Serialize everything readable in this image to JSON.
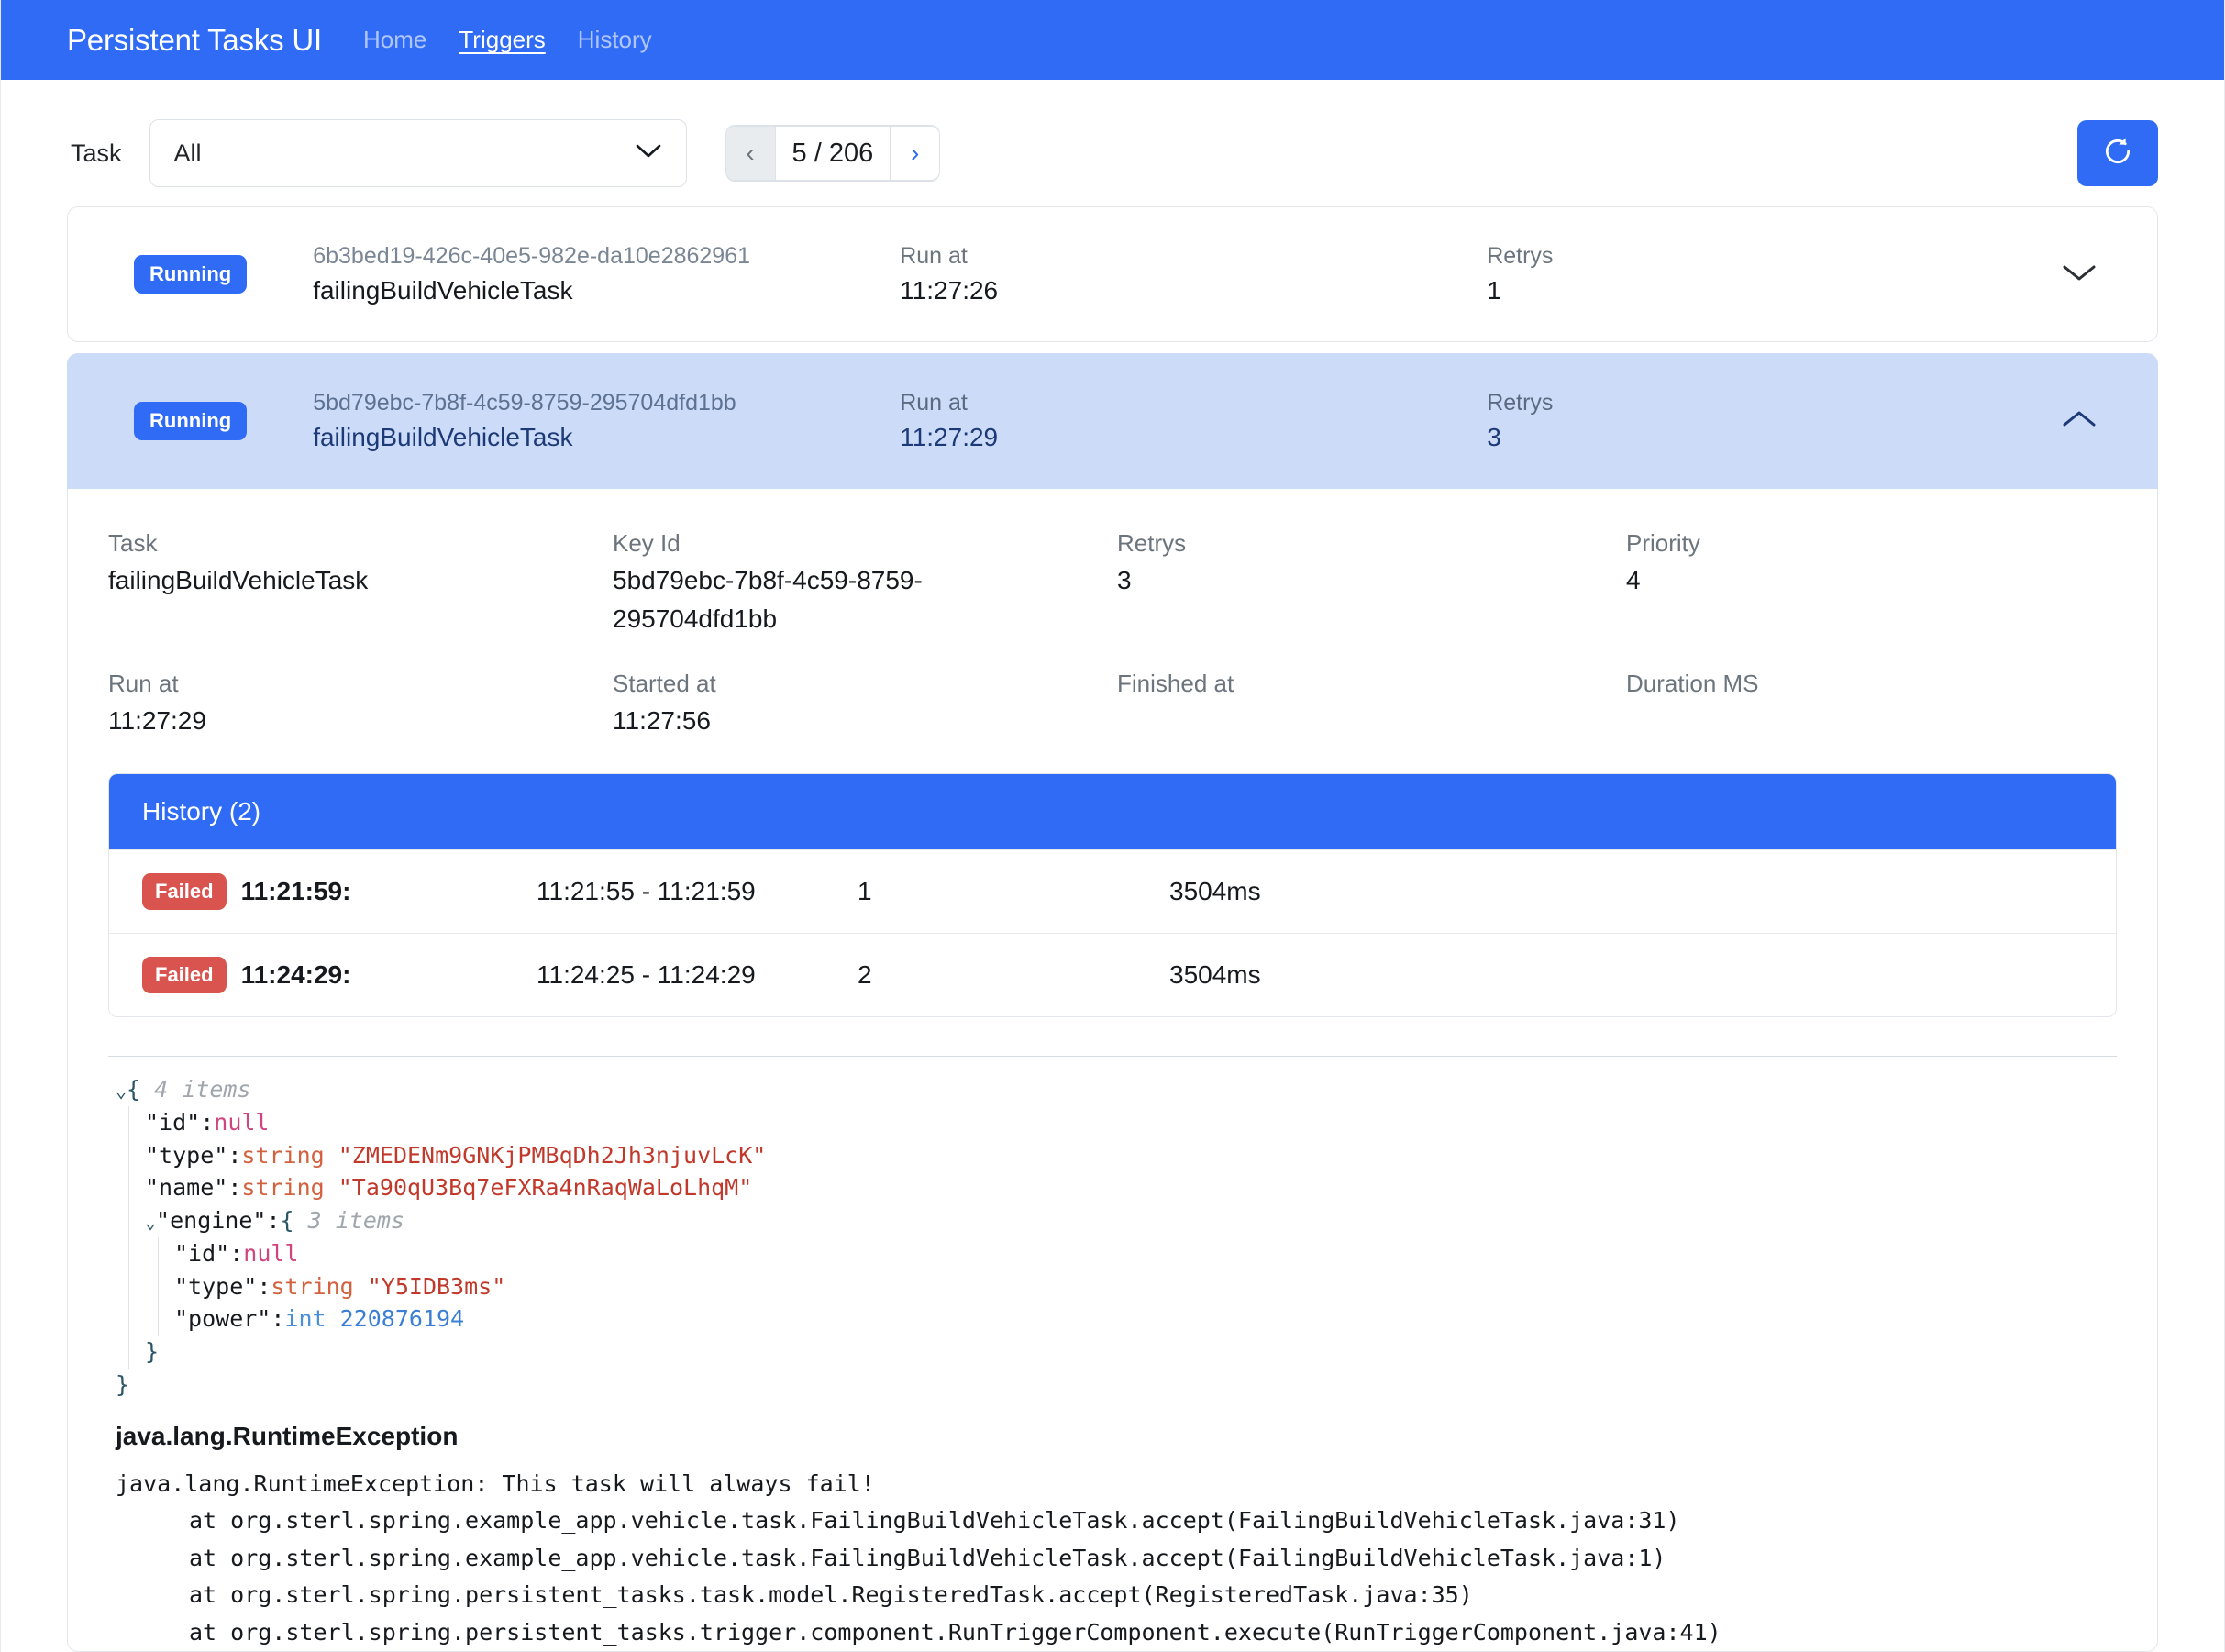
{
  "navbar": {
    "brand": "Persistent Tasks UI",
    "links": [
      {
        "label": "Home",
        "active": false
      },
      {
        "label": "Triggers",
        "active": true
      },
      {
        "label": "History",
        "active": false
      }
    ]
  },
  "toolbar": {
    "task_label": "Task",
    "select_value": "All",
    "select_options": [
      "All"
    ],
    "prev_label": "‹",
    "next_label": "›",
    "page_count": "5 / 206",
    "refresh_icon": "refresh-icon",
    "chevron_down_icon": "chevron-down-icon"
  },
  "rows": [
    {
      "status": "Running",
      "key_id": "6b3bed19-426c-40e5-982e-da10e2862961",
      "task": "failingBuildVehicleTask",
      "run_at_label": "Run at",
      "run_at": "11:27:26",
      "retrys_label": "Retrys",
      "retrys": "1",
      "chevron": "chevron-down-icon"
    },
    {
      "status": "Running",
      "key_id": "5bd79ebc-7b8f-4c59-8759-295704dfd1bb",
      "task": "failingBuildVehicleTask",
      "run_at_label": "Run at",
      "run_at": "11:27:29",
      "retrys_label": "Retrys",
      "retrys": "3",
      "chevron": "chevron-up-icon"
    }
  ],
  "detail": {
    "fields": [
      {
        "label": "Task",
        "value": "failingBuildVehicleTask"
      },
      {
        "label": "Key Id",
        "value": "5bd79ebc-7b8f-4c59-8759-295704dfd1bb"
      },
      {
        "label": "Retrys",
        "value": "3"
      },
      {
        "label": "Priority",
        "value": "4"
      },
      {
        "label": "Run at",
        "value": "11:27:29"
      },
      {
        "label": "Started at",
        "value": "11:27:56"
      },
      {
        "label": "Finished at",
        "value": ""
      },
      {
        "label": "Duration MS",
        "value": ""
      }
    ],
    "history": {
      "title": "History (2)",
      "rows": [
        {
          "status": "Failed",
          "time": "11:21:59:",
          "range": "11:21:55 - 11:21:59",
          "attempt": "1",
          "duration": "3504ms"
        },
        {
          "status": "Failed",
          "time": "11:24:29:",
          "range": "11:24:25 - 11:24:29",
          "attempt": "2",
          "duration": "3504ms"
        }
      ]
    },
    "json_viewer": {
      "root_count": "4 items",
      "engine_count": "3 items",
      "keys": {
        "id": "\"id\"",
        "type": "\"type\"",
        "name": "\"name\"",
        "engine": "\"engine\"",
        "power": "\"power\""
      },
      "values": {
        "id": "null",
        "type_label": "string",
        "type": "\"ZMEDENm9GNKjPMBqDh2Jh3njuvLcK\"",
        "name_label": "string",
        "name": "\"Ta90qU3Bq7eFXRa4nRaqWaLoLhqM\"",
        "engine_id": "null",
        "engine_type_label": "string",
        "engine_type": "\"Y5IDB3ms\"",
        "power_label": "int",
        "power": "220876194"
      }
    },
    "exception": {
      "title": "java.lang.RuntimeException",
      "message": "java.lang.RuntimeException: This task will always fail!",
      "frames": [
        "at org.sterl.spring.example_app.vehicle.task.FailingBuildVehicleTask.accept(FailingBuildVehicleTask.java:31)",
        "at org.sterl.spring.example_app.vehicle.task.FailingBuildVehicleTask.accept(FailingBuildVehicleTask.java:1)",
        "at org.sterl.spring.persistent_tasks.task.model.RegisteredTask.accept(RegisteredTask.java:35)",
        "at org.sterl.spring.persistent_tasks.trigger.component.RunTriggerComponent.execute(RunTriggerComponent.java:41)"
      ]
    }
  },
  "colors": {
    "brand_blue": "#2f6bf5",
    "selected_row": "#ccdbf8",
    "failed_red": "#d9534f"
  }
}
